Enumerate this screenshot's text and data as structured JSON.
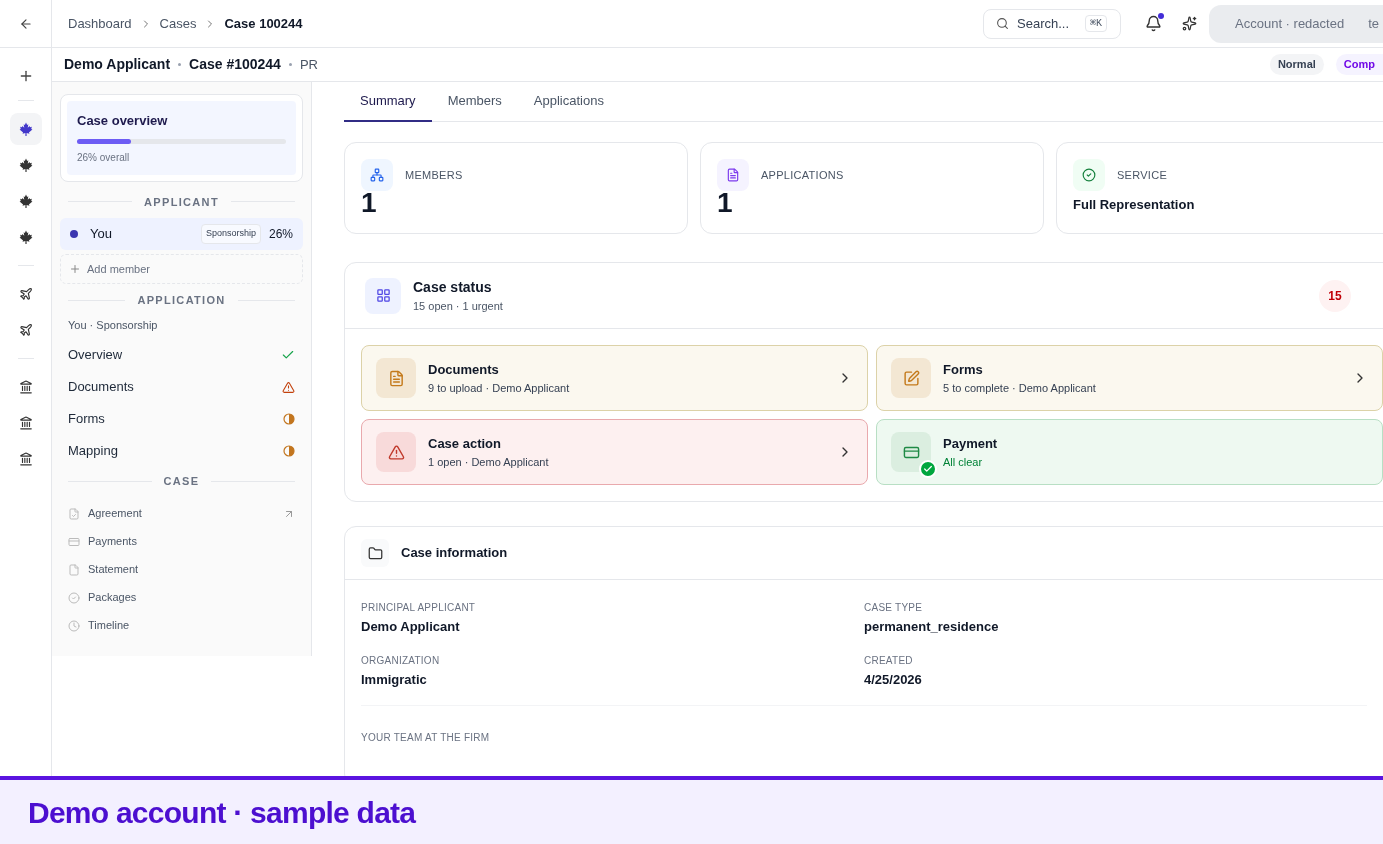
{
  "breadcrumbs": [
    {
      "label": "Dashboard",
      "current": false
    },
    {
      "label": "Cases",
      "current": false
    },
    {
      "label": "Case 100244",
      "current": true
    }
  ],
  "search": {
    "placeholder": "Search...",
    "shortcut": "⌘K"
  },
  "notifications": {
    "unread": true
  },
  "account": {
    "label": "Account · redacted",
    "extra": "te"
  },
  "rail": [
    {
      "kind": "leaf",
      "selected": true
    },
    {
      "kind": "leaf",
      "selected": false
    },
    {
      "kind": "leaf",
      "selected": false
    },
    {
      "kind": "leaf",
      "selected": false
    },
    {
      "kind": "plane",
      "selected": false
    },
    {
      "kind": "plane",
      "selected": false
    },
    {
      "kind": "building",
      "selected": false
    },
    {
      "kind": "building",
      "selected": false
    },
    {
      "kind": "building",
      "selected": false
    }
  ],
  "case_header": {
    "applicant": "Demo Applicant",
    "case_number": "Case #100244",
    "program": "PR",
    "badges": [
      {
        "label": "Normal",
        "kind": "neutral"
      },
      {
        "label": "Comp",
        "kind": "accent"
      }
    ]
  },
  "overview": {
    "title": "Case overview",
    "level": 0.26,
    "caption": "26% overall"
  },
  "applicant_section": {
    "title": "APPLICANT",
    "members": [
      {
        "name": "You",
        "tag": "Sponsorship",
        "percent": "26%",
        "color": "#3b36b0",
        "selected": true
      }
    ],
    "add_label": "Add member"
  },
  "application_section": {
    "title": "APPLICATION",
    "subtitle": "You · Sponsorship",
    "items": [
      {
        "label": "Overview",
        "kind": "done"
      },
      {
        "label": "Documents",
        "kind": "warning"
      },
      {
        "label": "Forms",
        "kind": "partial"
      },
      {
        "label": "Mapping",
        "kind": "partial"
      }
    ]
  },
  "case_section": {
    "title": "CASE",
    "items": [
      {
        "label": "Agreement",
        "kind": "agreement",
        "external": true
      },
      {
        "label": "Payments",
        "kind": "payments",
        "external": false
      },
      {
        "label": "Statement",
        "kind": "statement",
        "external": false
      },
      {
        "label": "Packages",
        "kind": "packages",
        "external": false
      },
      {
        "label": "Timeline",
        "kind": "timeline",
        "external": false
      }
    ]
  },
  "tabs": [
    {
      "label": "Summary",
      "selected": true
    },
    {
      "label": "Members",
      "selected": false
    },
    {
      "label": "Applications",
      "selected": false
    }
  ],
  "stats": [
    {
      "kind": "members",
      "label": "MEMBERS",
      "value": "1"
    },
    {
      "kind": "applications",
      "label": "APPLICATIONS",
      "value": "1"
    },
    {
      "kind": "service",
      "label": "SERVICE",
      "value": "Full Representation"
    }
  ],
  "case_status": {
    "title": "Case status",
    "subtitle": "15 open · 1 urgent",
    "count": "15",
    "tiles": [
      {
        "kind": "documents",
        "title": "Documents",
        "detail": "9 to upload · Demo Applicant",
        "chevron": true
      },
      {
        "kind": "forms",
        "title": "Forms",
        "detail": "5 to complete · Demo Applicant",
        "chevron": true
      },
      {
        "kind": "action",
        "title": "Case action",
        "detail": "1 open · Demo Applicant",
        "chevron": true
      },
      {
        "kind": "payment",
        "title": "Payment",
        "detail": "All clear",
        "chevron": false
      }
    ]
  },
  "case_information": {
    "title": "Case information",
    "fields": [
      {
        "label": "PRINCIPAL APPLICANT",
        "value": "Demo Applicant"
      },
      {
        "label": "CASE TYPE",
        "value": "permanent_residence"
      },
      {
        "label": "ORGANIZATION",
        "value": "Immigratic"
      },
      {
        "label": "CREATED",
        "value": "4/25/2026"
      }
    ],
    "team_title": "YOUR TEAM AT THE FIRM"
  },
  "banner": {
    "text": "Demo account · sample data"
  }
}
